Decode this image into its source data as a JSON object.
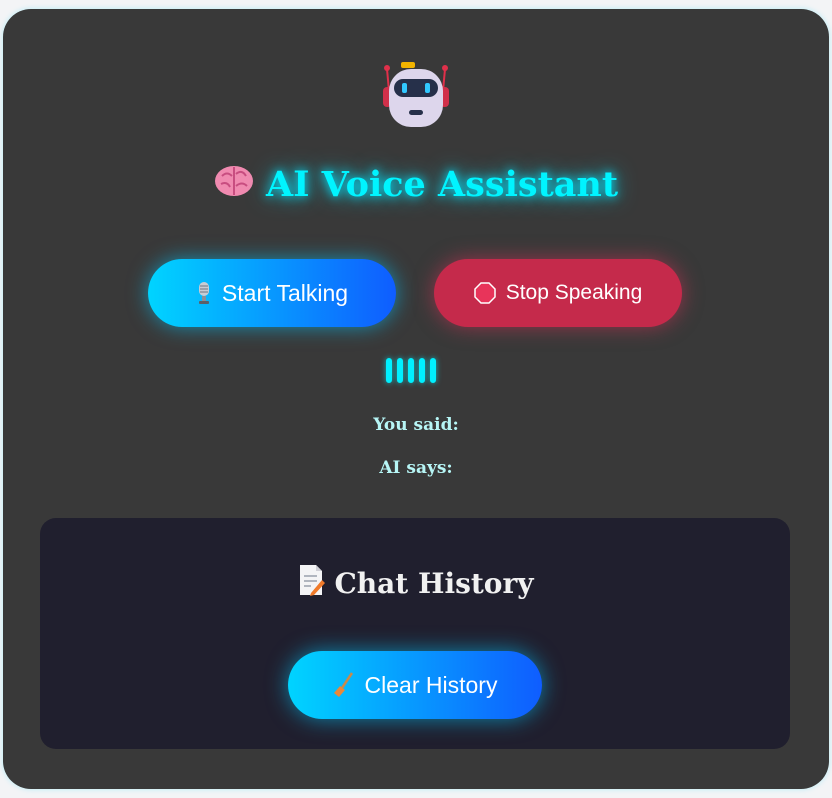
{
  "app": {
    "title": "AI Voice Assistant"
  },
  "icons": {
    "robot": "robot-icon",
    "brain": "brain-icon",
    "mic": "microphone-icon",
    "stop": "stop-sign-icon",
    "memo": "memo-icon",
    "broom": "broom-icon"
  },
  "controls": {
    "start_label": "Start Talking",
    "stop_label": "Stop Speaking"
  },
  "transcript": {
    "you_said_label": "You said:",
    "ai_says_label": "AI says:"
  },
  "history": {
    "title": "Chat History",
    "clear_label": "Clear History"
  },
  "colors": {
    "card_bg": "#393939",
    "accent_cyan": "#00f4ff",
    "start_gradient_from": "#00d4ff",
    "start_gradient_to": "#0f5dff",
    "stop_bg": "#c52a4b",
    "panel_bg": "#201f2e"
  }
}
